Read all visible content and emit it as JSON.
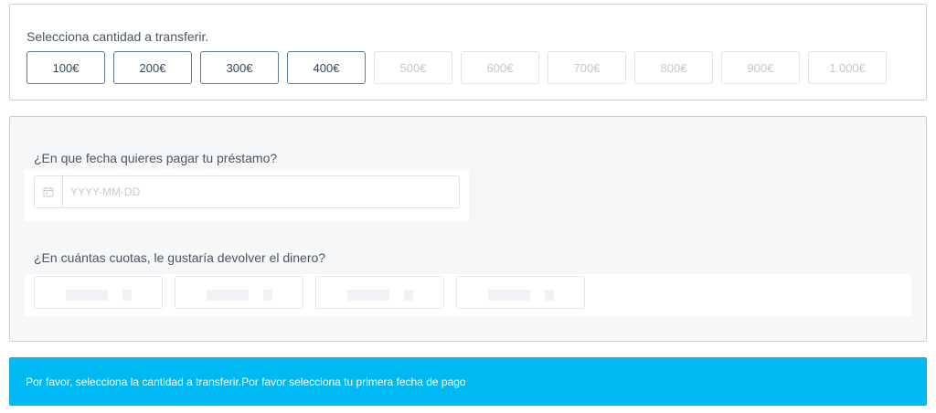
{
  "amount": {
    "title": "Selecciona cantidad a transferir.",
    "options": [
      {
        "label": "100€",
        "enabled": true
      },
      {
        "label": "200€",
        "enabled": true
      },
      {
        "label": "300€",
        "enabled": true
      },
      {
        "label": "400€",
        "enabled": true
      },
      {
        "label": "500€",
        "enabled": false
      },
      {
        "label": "600€",
        "enabled": false
      },
      {
        "label": "700€",
        "enabled": false
      },
      {
        "label": "800€",
        "enabled": false
      },
      {
        "label": "900€",
        "enabled": false
      },
      {
        "label": "1.000€",
        "enabled": false
      }
    ]
  },
  "schedule": {
    "date_question": "¿En que fecha quieres pagar tu préstamo?",
    "date_placeholder": "YYYY-MM-DD",
    "date_icon": "calendar-icon",
    "installments_question": "¿En cuántas cuotas, le gustaría devolver el dinero?",
    "installment_options_count_visible": 4
  },
  "notice": {
    "text": "Por favor, selecciona la cantidad a transferir.Por favor selecciona tu primera fecha de pago",
    "color": "#00b9f2"
  },
  "colors": {
    "enabled_border": "#5d7a97",
    "disabled_border": "#dfe4ea",
    "disabled_text": "#c2c8d0"
  }
}
